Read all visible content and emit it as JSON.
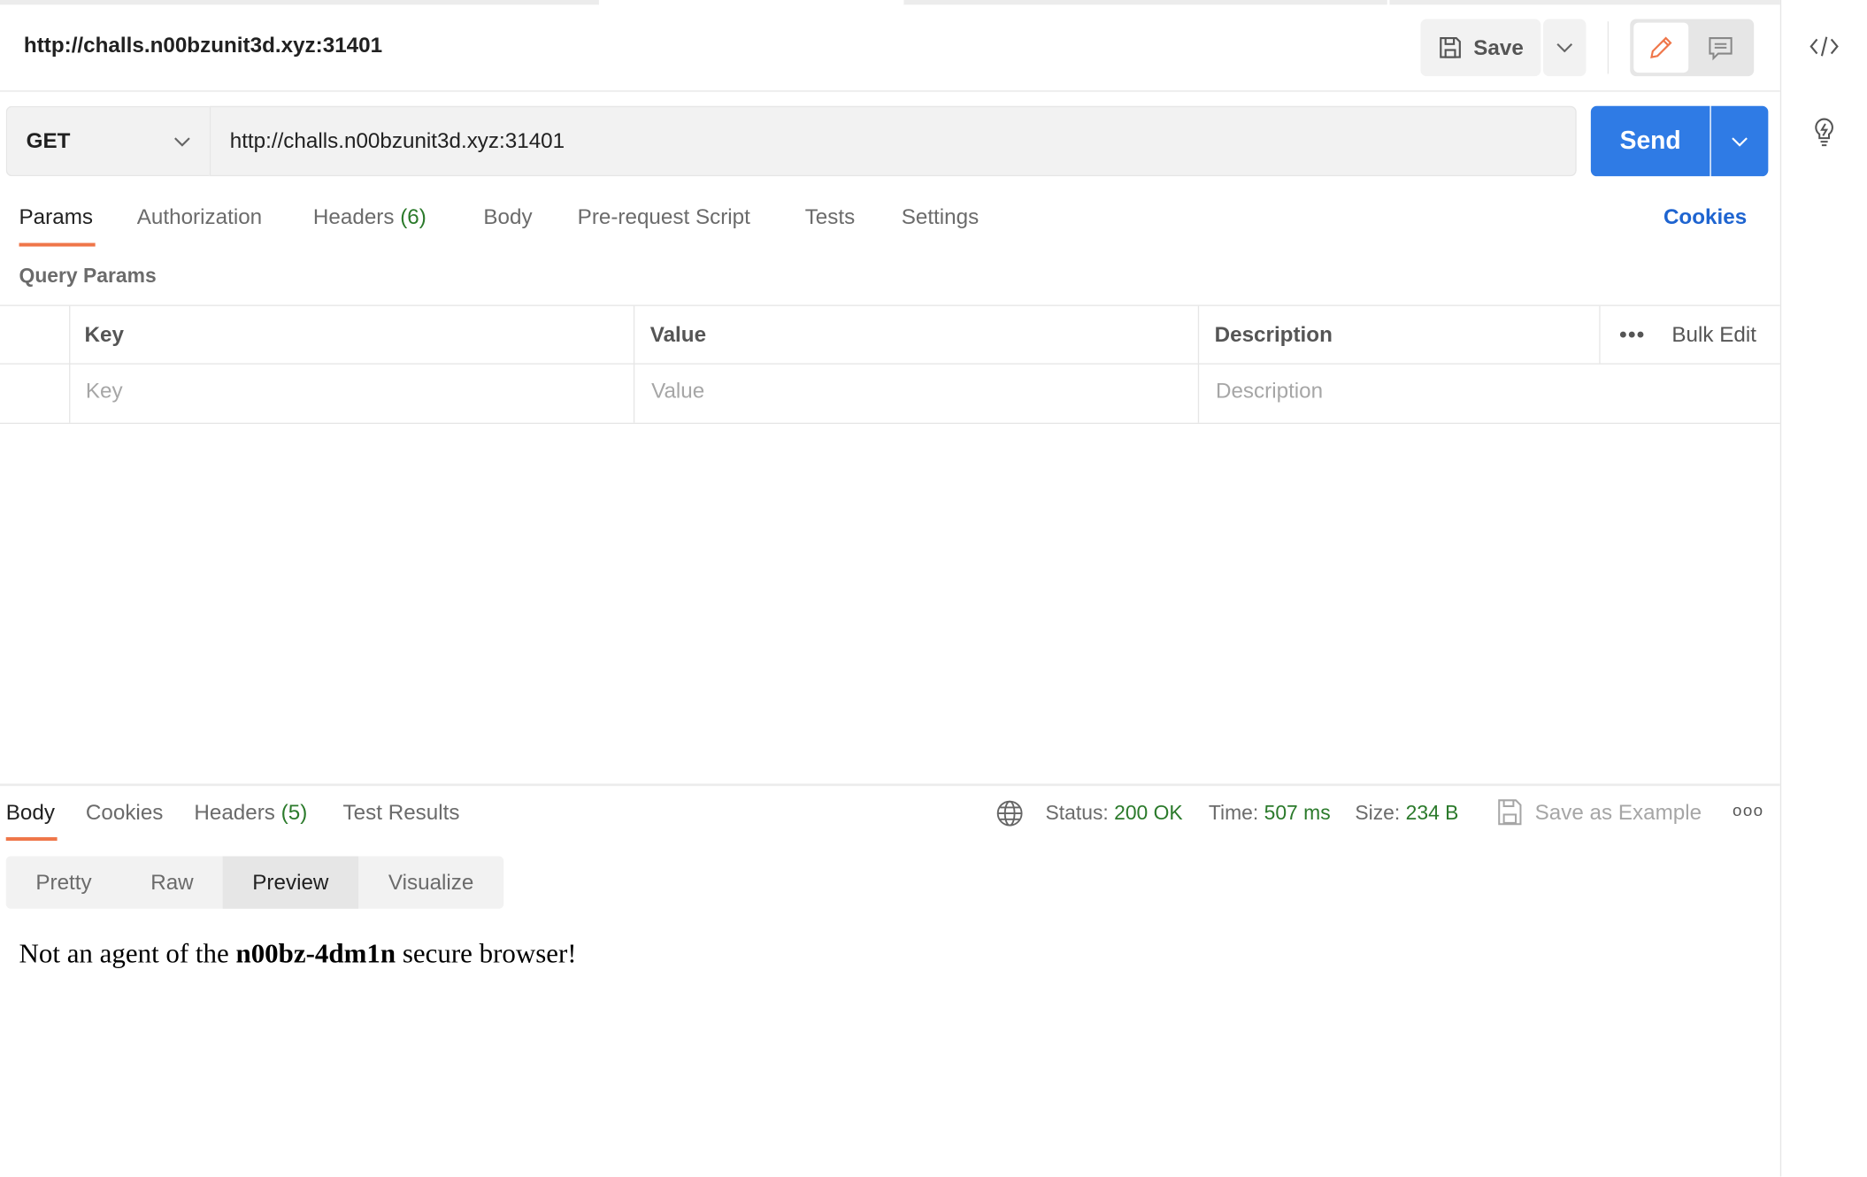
{
  "request": {
    "title": "http://challs.n00bzunit3d.xyz:31401",
    "save_label": "Save",
    "method": "GET",
    "url": "http://challs.n00bzunit3d.xyz:31401",
    "send_label": "Send"
  },
  "tabs": [
    {
      "label": "Params"
    },
    {
      "label": "Authorization"
    },
    {
      "label": "Headers",
      "count": "(6)"
    },
    {
      "label": "Body"
    },
    {
      "label": "Pre-request Script"
    },
    {
      "label": "Tests"
    },
    {
      "label": "Settings"
    }
  ],
  "cookies_link": "Cookies",
  "query_params": {
    "title": "Query Params",
    "headers": [
      "Key",
      "Value",
      "Description"
    ],
    "bulk_edit": "Bulk Edit",
    "placeholders": [
      "Key",
      "Value",
      "Description"
    ]
  },
  "response": {
    "tabs": [
      {
        "label": "Body"
      },
      {
        "label": "Cookies"
      },
      {
        "label": "Headers",
        "count": "(5)"
      },
      {
        "label": "Test Results"
      }
    ],
    "status_label": "Status:",
    "status": "200 OK",
    "time_label": "Time:",
    "time": "507 ms",
    "size_label": "Size:",
    "size": "234 B",
    "save_example": "Save as Example",
    "views": [
      "Pretty",
      "Raw",
      "Preview",
      "Visualize"
    ],
    "selected_view": "Preview",
    "preview": {
      "before": "Not an agent of the ",
      "bold": "n00bz-4dm1n",
      "after": " secure browser!"
    }
  },
  "colors": {
    "accent": "#ef7649",
    "send": "#2f7be5",
    "link": "#1e64d0",
    "success": "#2b7a2b"
  }
}
